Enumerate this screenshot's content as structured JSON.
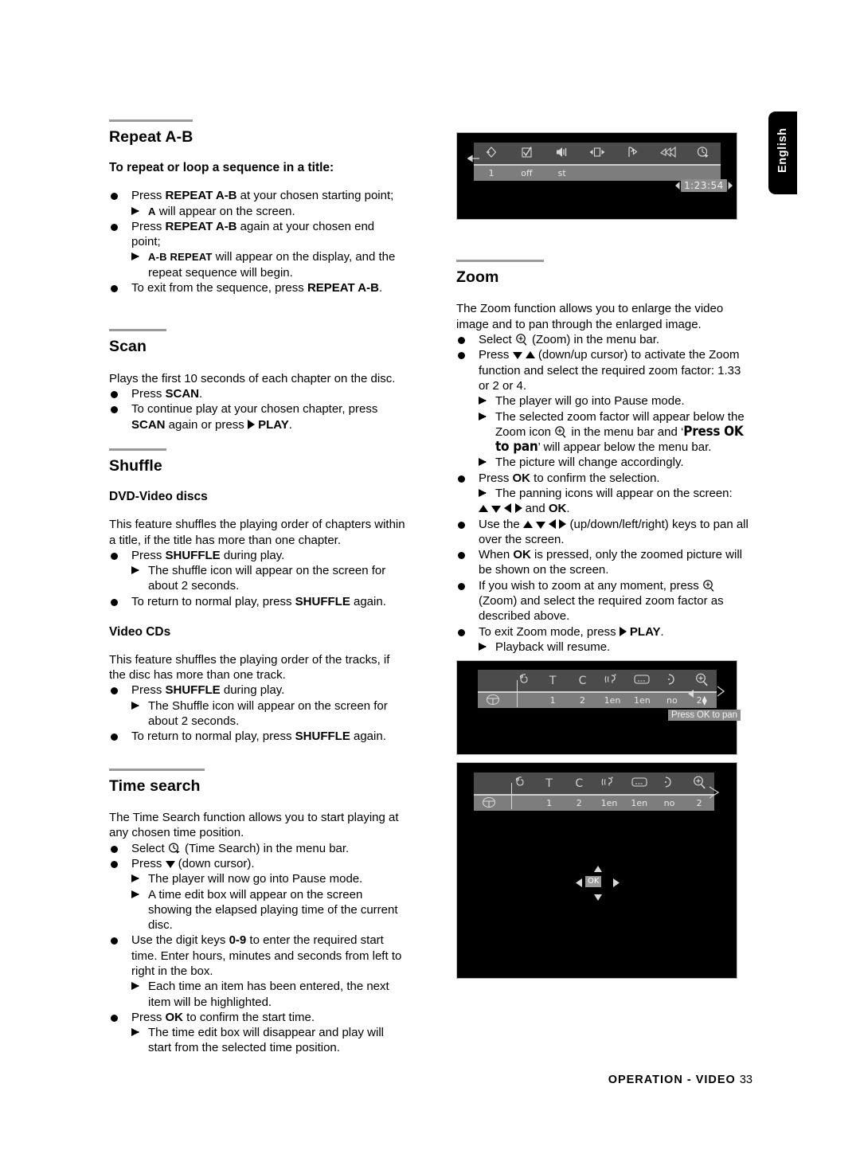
{
  "language_tab": {
    "label": "English"
  },
  "footer": {
    "label": "OPERATION - VIDEO",
    "page": "33"
  },
  "left_column": {
    "repeat_ab": {
      "heading": "Repeat A-B",
      "subheading": "To repeat or loop a sequence in a title:",
      "bullets": [
        {
          "pre": "Press ",
          "bold": "REPEAT A-B",
          "post": " at your chosen starting point;"
        },
        {
          "pre": "Press ",
          "bold": "REPEAT A-B",
          "post": " again at your chosen end point;"
        },
        {
          "pre": "To exit from the sequence, press ",
          "bold": "REPEAT A-B",
          "post": "."
        }
      ],
      "arrow_1": {
        "sc": "A",
        "rest": " will appear on the screen."
      },
      "arrow_2": {
        "sc": "A-B REPEAT",
        "rest": " will appear on the display, and the repeat sequence will begin."
      }
    },
    "scan": {
      "heading": "Scan",
      "intro": "Plays the first 10 seconds of each chapter on the disc.",
      "b1_pre": "Press ",
      "b1_bold": "SCAN",
      "b1_post": ".",
      "b2_line1": "To continue play at your chosen chapter, press",
      "b2_bold1": "SCAN",
      "b2_mid": " again or press ",
      "b2_bold2": "PLAY",
      "b2_post": "."
    },
    "shuffle": {
      "heading": "Shuffle",
      "dvd_sub": "DVD-Video discs",
      "dvd_intro": "This feature shuffles the playing order of chapters within a title, if the title has more than one chapter.",
      "dvd_b1_pre": "Press ",
      "dvd_b1_bold": "SHUFFLE",
      "dvd_b1_post": " during play.",
      "dvd_arrow": "The shuffle icon will appear on the screen for about 2 seconds.",
      "dvd_b2_pre": "To return to normal play, press ",
      "dvd_b2_bold": "SHUFFLE",
      "dvd_b2_post": " again.",
      "vcd_sub": "Video CDs",
      "vcd_intro": "This feature shuffles the playing order of the tracks, if the disc has more  than one track.",
      "vcd_b1_pre": "Press ",
      "vcd_b1_bold": "SHUFFLE",
      "vcd_b1_post": " during play.",
      "vcd_arrow": "The Shuffle icon will appear on the screen for about 2 seconds.",
      "vcd_b2_pre": "To return to normal play, press ",
      "vcd_b2_bold": "SHUFFLE",
      "vcd_b2_post": " again."
    },
    "time_search": {
      "heading": "Time search",
      "intro": "The Time Search function allows you to start playing at any chosen time position.",
      "b1_pre": "Select ",
      "b1_post": " (Time Search) in the menu bar.",
      "b2_pre": "Press ",
      "b2_post": " (down cursor).",
      "a1": "The player will now go into Pause mode.",
      "a2": "A time edit box will appear on the screen showing the elapsed playing time of the current disc.",
      "b3_pre": "Use the digit keys ",
      "b3_bold": "0-9",
      "b3_post": " to enter the required start time. Enter hours, minutes and seconds from left to right in the box.",
      "a3": "Each time an item has been entered, the next item will be highlighted.",
      "b4_pre": "Press ",
      "b4_bold": "OK",
      "b4_post": "  to confirm the start time.",
      "a4": "The time edit box will disappear and play will start from the selected time position."
    }
  },
  "right_column": {
    "zoom": {
      "heading": "Zoom",
      "intro": "The Zoom function allows you to enlarge the video image and to pan through the enlarged image.",
      "b1_pre": "Select ",
      "b1_post": " (Zoom) in the menu bar.",
      "b2_pre": "Press ",
      "b2_post": " (down/up cursor) to activate the Zoom function and select the required zoom factor: 1.33 or 2 or 4.",
      "a1": "The player will go into Pause mode.",
      "a2_pre": "The selected zoom factor will appear below the Zoom icon ",
      "a2_mid": " in the menu bar and ‘",
      "a2_cond": "Press OK to pan",
      "a2_post": "’ will appear below the menu bar.",
      "a3": "The picture will change accordingly.",
      "b3_pre": "Press ",
      "b3_bold": "OK",
      "b3_post": " to confirm the selection.",
      "a4": "The panning icons will appear on the screen:",
      "a4_bold": "OK",
      "a4_end": ".",
      "a4_and": " and ",
      "b4_pre": "Use the ",
      "b4_post": " (up/down/left/right) keys to pan all over the screen.",
      "b5_pre": "When ",
      "b5_bold": "OK",
      "b5_post": " is pressed, only the zoomed picture will be shown on the screen.",
      "b6_pre": "If you wish to zoom at any moment, press ",
      "b6_post": " (Zoom) and select the required zoom factor as described above.",
      "b7_pre": "To exit Zoom mode, press ",
      "b7_bold": "PLAY",
      "b7_post": ".",
      "a5": "Playback will resume."
    }
  },
  "screens": {
    "tv1": {
      "icons": [
        "disc-title-icon",
        "checkbox-icon",
        "audio-icon",
        "screen-fit-icon",
        "repeat-ab-icon",
        "scan-icon",
        "time-search-icon"
      ],
      "values": [
        "1",
        "off",
        "st",
        "",
        "",
        "",
        ""
      ],
      "time_box": "1:23:54"
    },
    "tv2": {
      "lead_icon": "disc-icon",
      "icons": [
        "disc-title-icon",
        "title-icon",
        "chapter-icon",
        "audio-language-icon",
        "subtitle-icon",
        "angle-icon",
        "zoom-icon"
      ],
      "labels": [
        "T",
        "C",
        "",
        "",
        "",
        ""
      ],
      "values": [
        "1",
        "2",
        "1en",
        "1en",
        "no",
        "2"
      ],
      "zoom_value": "2",
      "ok_pan": "Press OK to pan"
    },
    "tv3": {
      "lead_icon": "disc-icon",
      "icons": [
        "disc-title-icon",
        "title-icon",
        "chapter-icon",
        "audio-language-icon",
        "subtitle-icon",
        "angle-icon",
        "zoom-icon"
      ],
      "values": [
        "1",
        "2",
        "1en",
        "1en",
        "no",
        "2"
      ],
      "pan_ok": "OK"
    }
  }
}
